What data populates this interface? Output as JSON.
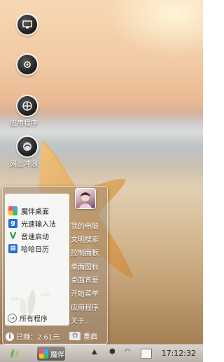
{
  "desktop": {
    "icons": [
      {
        "name": "monitor-icon",
        "label": ""
      },
      {
        "name": "settings-icon",
        "label": ""
      },
      {
        "name": "apps-icon",
        "label": "应用程序"
      },
      {
        "name": "browser-icon",
        "label": "网上冲浪"
      }
    ]
  },
  "start_menu": {
    "favorites": [
      {
        "label": "魔伴桌面",
        "icon": "mobang-icon",
        "color": "#3c8ee8"
      },
      {
        "label": "光速输入法",
        "icon": "input-method-icon",
        "color": "#2b6fd6"
      },
      {
        "label": "音速启动",
        "icon": "launcher-icon",
        "color": "#2c9a46"
      },
      {
        "label": "哈哈日历",
        "icon": "calendar-icon",
        "color": "#2a6cc9"
      }
    ],
    "all_programs": "所有程序",
    "links": [
      "我的电脑",
      "文明搜索",
      "控制面板",
      "桌面图标",
      "桌面背景",
      "开始菜单",
      "应用程序",
      "关于..."
    ],
    "earned": "已赚：2.61元",
    "restart": "重启"
  },
  "taskbar": {
    "task_label": "魔伴",
    "clock": "17:12:32"
  }
}
